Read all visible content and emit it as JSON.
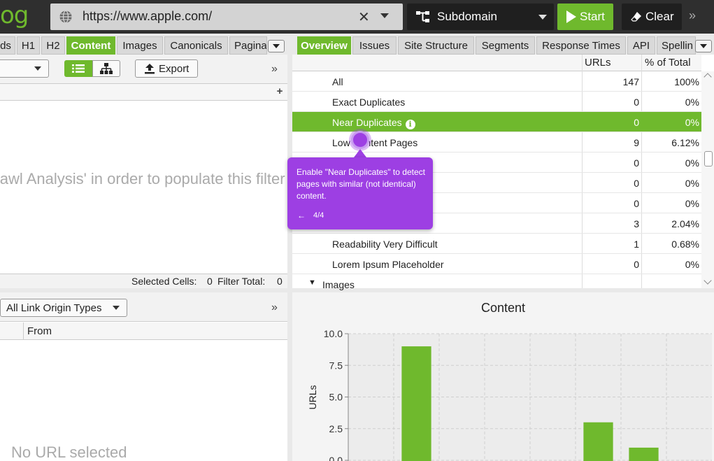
{
  "topbar": {
    "logo_text": "og",
    "url": "https://www.apple.com/",
    "clear_url_glyph": "✕",
    "mode": "Subdomain",
    "start_label": "Start",
    "clear_label": "Clear",
    "more_glyph": "»",
    "icons": [
      "globe-icon",
      "subdomain-tree-icon",
      "play-icon",
      "eraser-icon"
    ]
  },
  "left_tabs": [
    {
      "label": "ds",
      "active": false
    },
    {
      "label": "H1",
      "active": false
    },
    {
      "label": "H2",
      "active": false
    },
    {
      "label": "Content",
      "active": true
    },
    {
      "label": "Images",
      "active": false
    },
    {
      "label": "Canonicals",
      "active": false
    },
    {
      "label": "Pagina",
      "active": false
    }
  ],
  "right_tabs": [
    {
      "label": "Overview",
      "active": true
    },
    {
      "label": "Issues",
      "active": false
    },
    {
      "label": "Site Structure",
      "active": false
    },
    {
      "label": "Segments",
      "active": false
    },
    {
      "label": "Response Times",
      "active": false
    },
    {
      "label": "API",
      "active": false
    },
    {
      "label": "Spellin",
      "active": false
    }
  ],
  "left_top": {
    "export_label": "Export",
    "more_glyph": "»",
    "plus_glyph": "+",
    "empty_message": "rawl Analysis' in order to populate this filter",
    "selected_cells_label": "Selected Cells:",
    "selected_cells_value": "0",
    "filter_total_label": "Filter Total:",
    "filter_total_value": "0"
  },
  "overview": {
    "col_urls": "URLs",
    "col_pct": "% of Total",
    "rows": [
      {
        "name": "All",
        "urls": "147",
        "pct": "100%",
        "selected": false
      },
      {
        "name": "Exact Duplicates",
        "urls": "0",
        "pct": "0%",
        "selected": false
      },
      {
        "name": "Near Duplicates",
        "urls": "0",
        "pct": "0%",
        "selected": true
      },
      {
        "name": "Low Content Pages",
        "urls": "9",
        "pct": "6.12%",
        "selected": false
      },
      {
        "name": "",
        "urls": "0",
        "pct": "0%",
        "selected": false
      },
      {
        "name": "",
        "urls": "0",
        "pct": "0%",
        "selected": false
      },
      {
        "name": "",
        "urls": "0",
        "pct": "0%",
        "selected": false
      },
      {
        "name": "",
        "urls": "3",
        "pct": "2.04%",
        "selected": false
      },
      {
        "name": "Readability Very Difficult",
        "urls": "1",
        "pct": "0.68%",
        "selected": false
      },
      {
        "name": "Lorem Ipsum Placeholder",
        "urls": "0",
        "pct": "0%",
        "selected": false
      }
    ],
    "group_row": {
      "name": "Images",
      "glyph": "▼"
    }
  },
  "tooltip": {
    "text": "Enable \"Near Duplicates\" to detect pages with similar (not identical) content.",
    "back_glyph": "←",
    "step": "4/4"
  },
  "left_bottom": {
    "select_label": "All Link Origin Types",
    "more_glyph": "»",
    "col_from": "From",
    "no_url": "No URL selected"
  },
  "chart_data": {
    "type": "bar",
    "title": "Content",
    "ylabel": "URLs",
    "xlabel": "",
    "ylim": [
      0,
      10
    ],
    "yticks": [
      "0.0",
      "2.5",
      "5.0",
      "7.5",
      "10.0"
    ],
    "values": [
      0,
      9,
      0,
      0,
      0,
      3,
      1,
      0
    ],
    "colors": {
      "bar": "#6fb92d",
      "grid": "#cfcfcf",
      "plot_bg": "#ececec"
    }
  }
}
